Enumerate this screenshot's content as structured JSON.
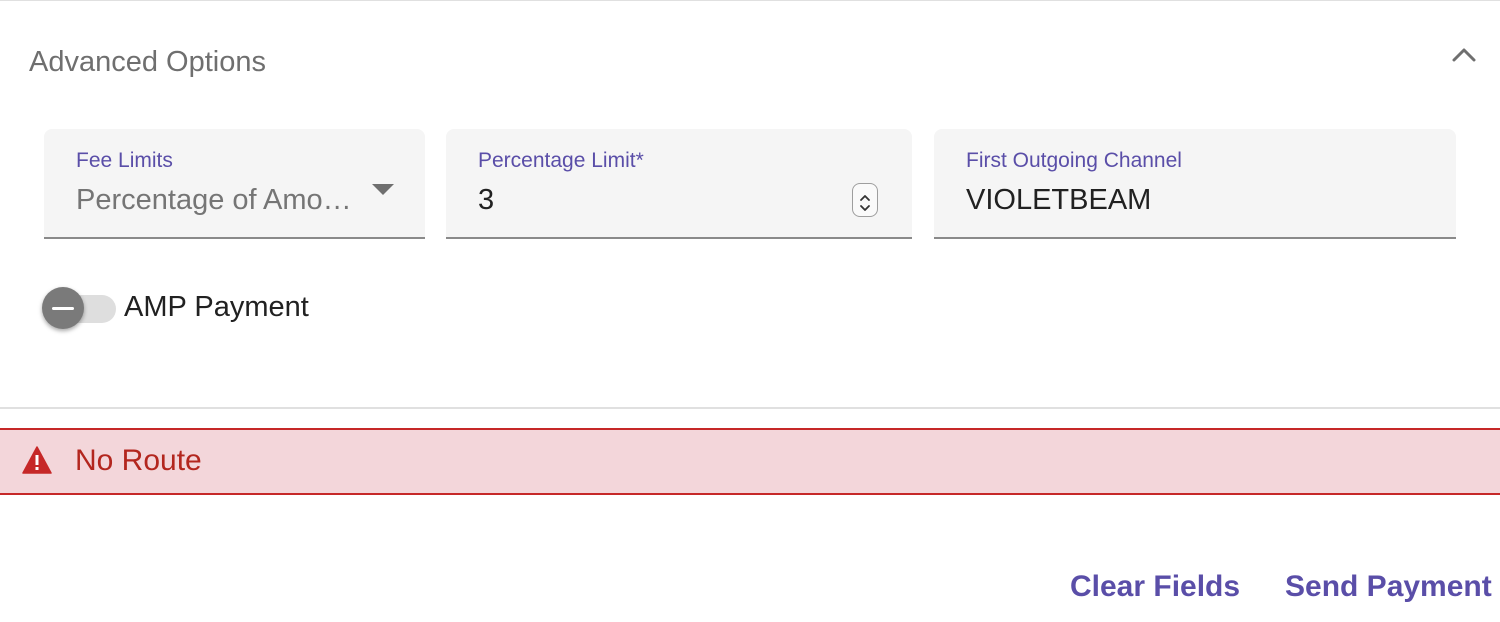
{
  "advanced_options": {
    "title": "Advanced Options",
    "expanded": true,
    "fee_limits": {
      "label": "Fee Limits",
      "value": "Percentage of Amo…"
    },
    "percentage_limit": {
      "label": "Percentage Limit*",
      "value": "3"
    },
    "first_outgoing_channel": {
      "label": "First Outgoing Channel",
      "value": "VIOLETBEAM"
    },
    "amp_payment": {
      "label": "AMP Payment",
      "enabled": false
    }
  },
  "alert": {
    "type": "error",
    "message": "No Route"
  },
  "actions": {
    "clear_label": "Clear Fields",
    "send_label": "Send Payment"
  },
  "colors": {
    "accent": "#5a4ea8",
    "error_text": "#b3261e",
    "error_bg": "#f3d6da"
  }
}
